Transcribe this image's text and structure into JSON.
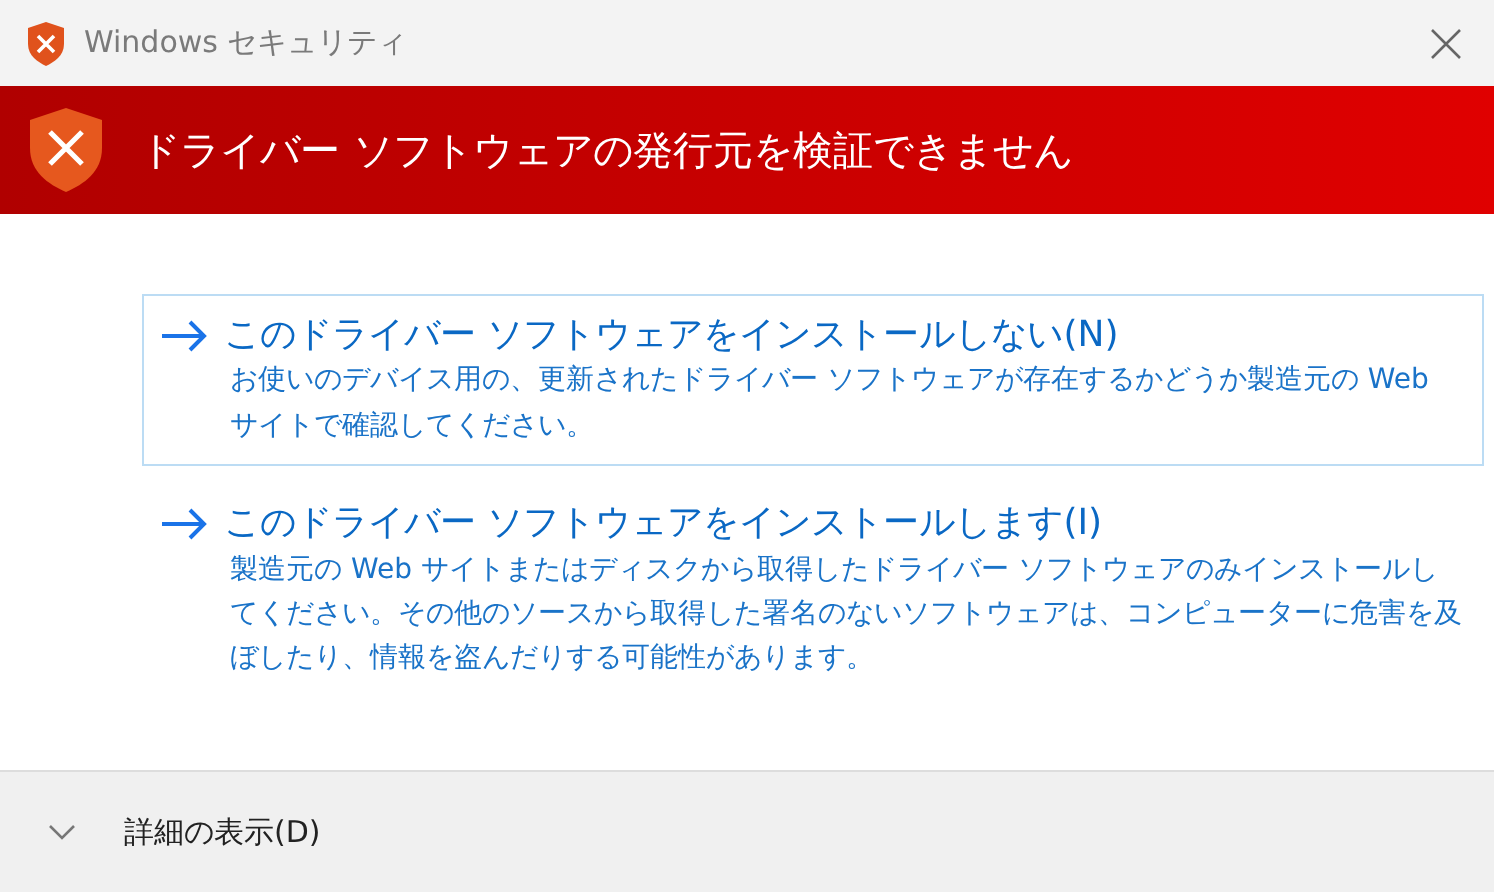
{
  "window": {
    "title": "Windows セキュリティ"
  },
  "banner": {
    "heading": "ドライバー ソフトウェアの発行元を検証できません"
  },
  "options": [
    {
      "title": "このドライバー ソフトウェアをインストールしない(N)",
      "description": "お使いのデバイス用の、更新されたドライバー ソフトウェアが存在するかどうか製造元の Web サイトで確認してください。",
      "selected": true
    },
    {
      "title": "このドライバー ソフトウェアをインストールします(I)",
      "description": "製造元の Web サイトまたはディスクから取得したドライバー ソフトウェアのみインストールしてください。その他のソースから取得した署名のないソフトウェアは、コンピューターに危害を及ぼしたり、情報を盗んだりする可能性があります。",
      "selected": false
    }
  ],
  "footer": {
    "details_label": "詳細の表示(D)",
    "expanded": false
  }
}
